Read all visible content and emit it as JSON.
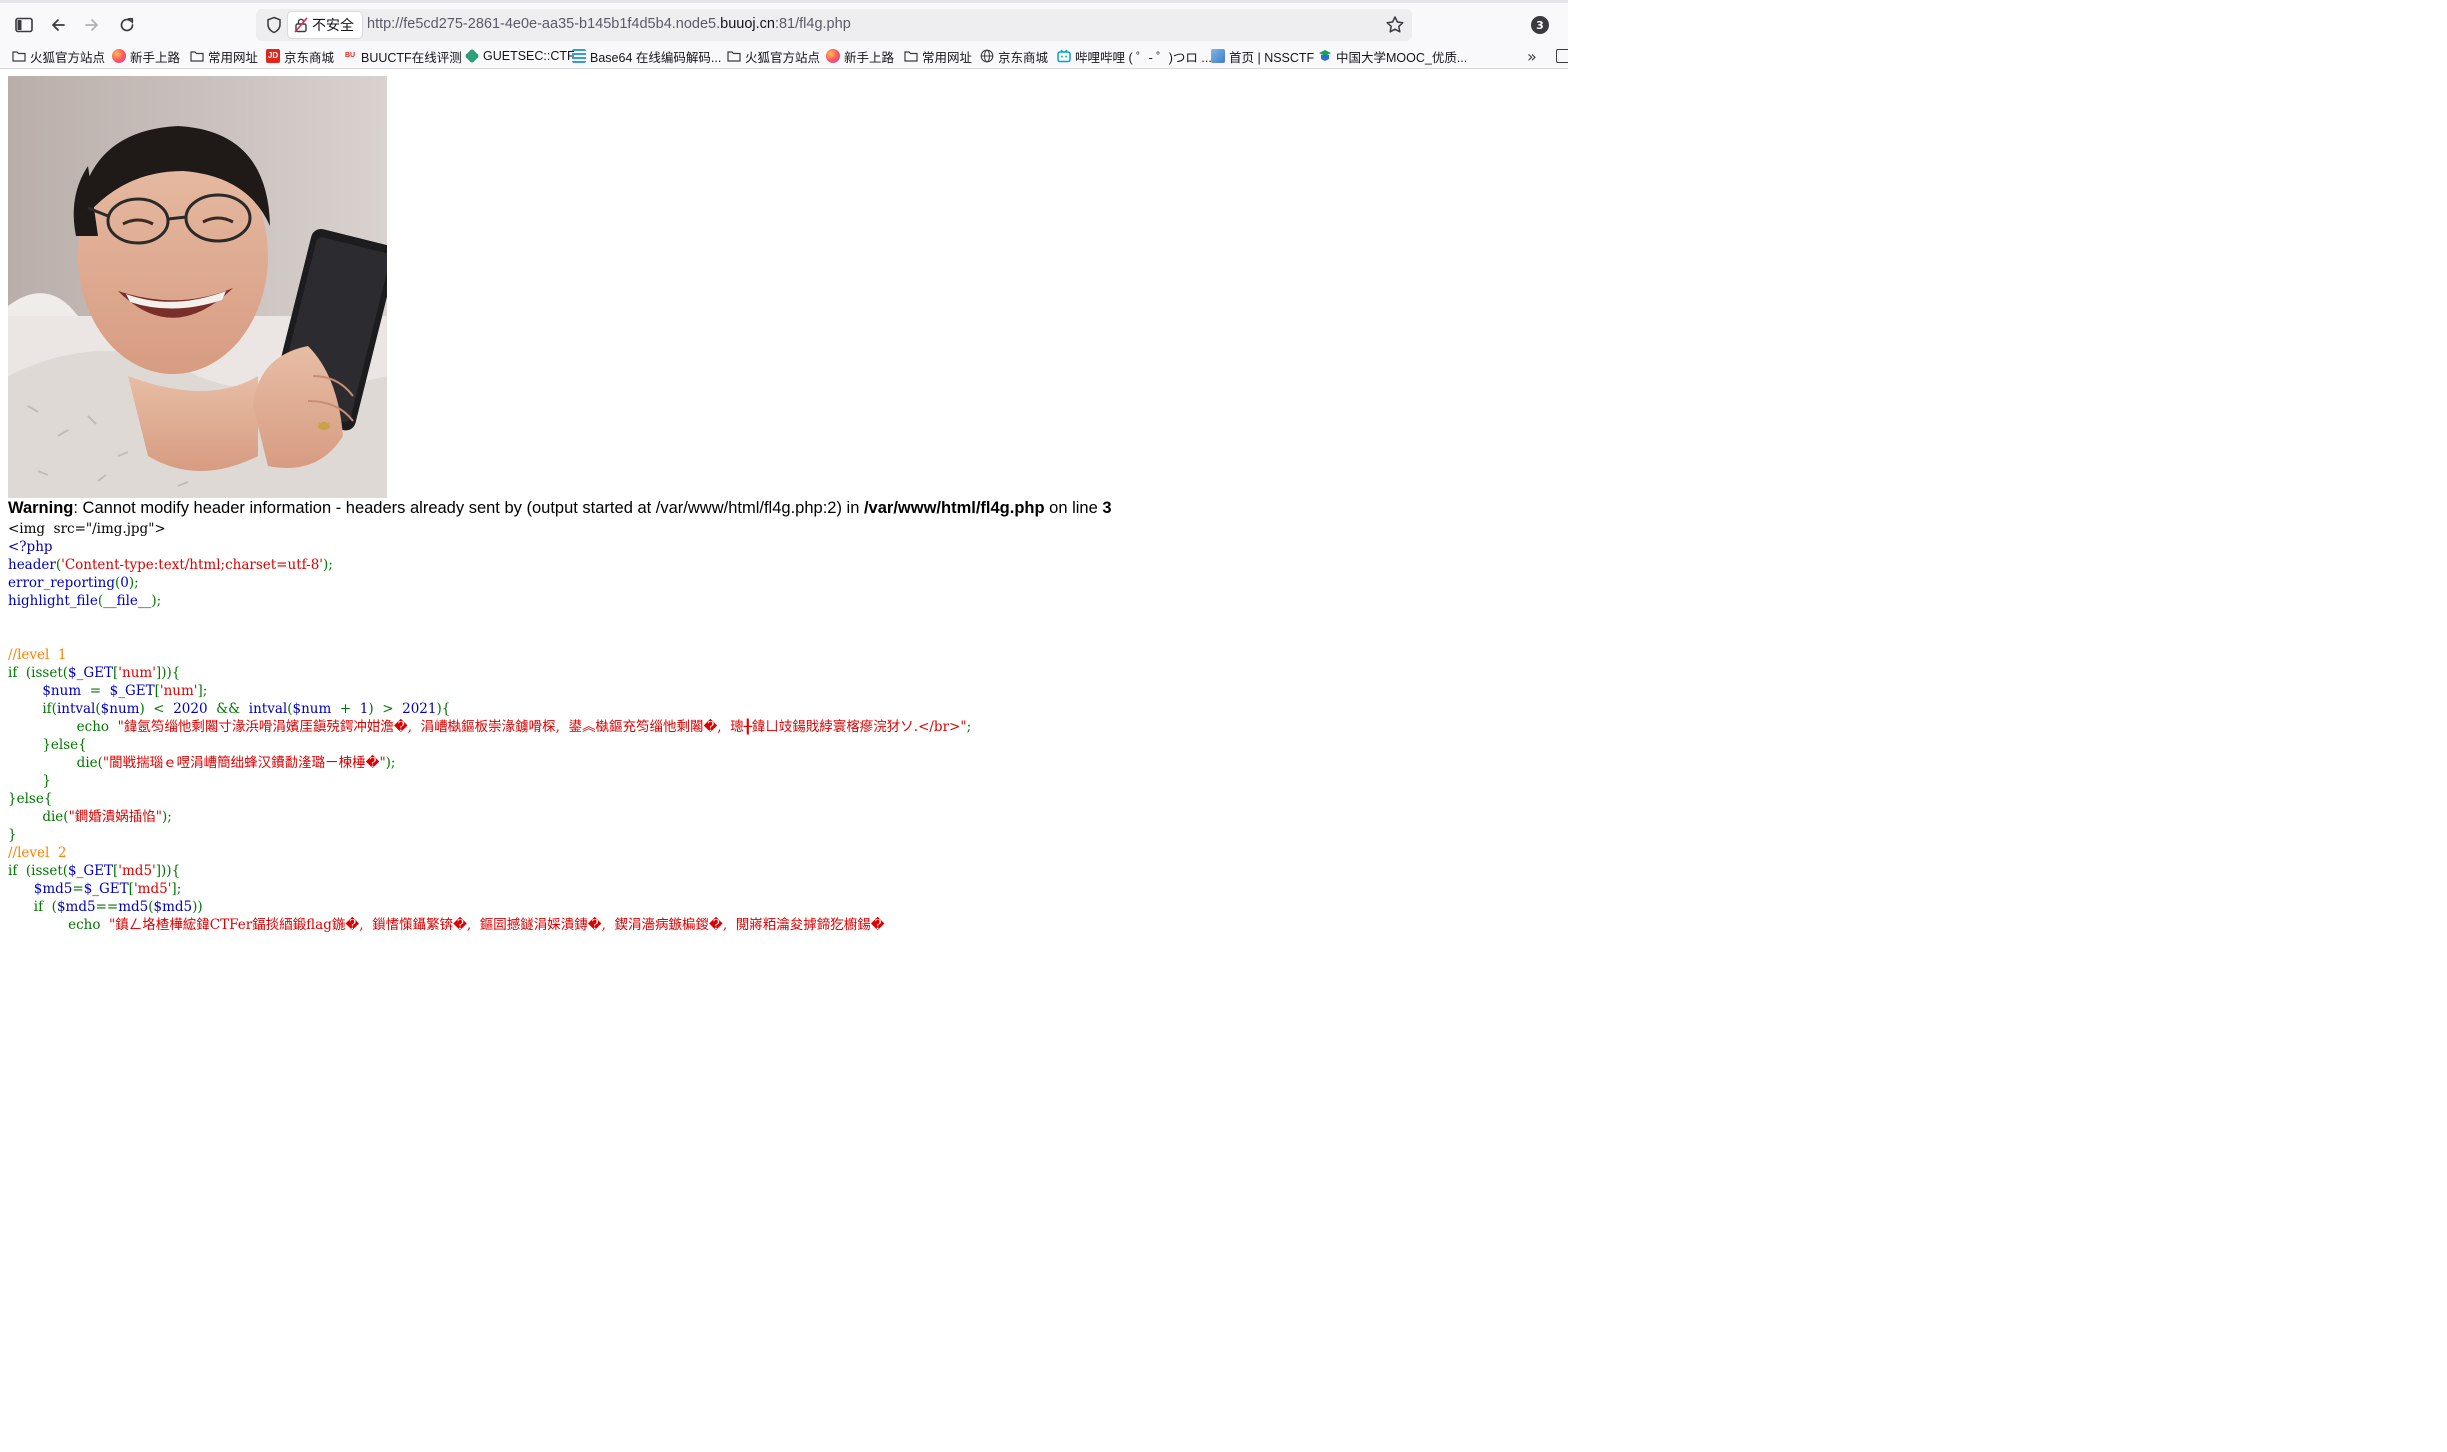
{
  "browser": {
    "address": {
      "security_label": "不安全",
      "url_prefix": "http://fe5cd275-2861-4e0e-aa35-b145b1f4d5b4.node5.",
      "url_domain": "buuoj.cn",
      "url_suffix": ":81/fl4g.php"
    },
    "extension_badge": "3",
    "bookmarks": [
      {
        "label": "火狐官方站点",
        "icon": "folder-icon"
      },
      {
        "label": "新手上路",
        "icon": "firefox-icon"
      },
      {
        "label": "常用网址",
        "icon": "folder-icon"
      },
      {
        "label": "京东商城",
        "icon": "jd-icon"
      },
      {
        "label": "BUUCTF在线评测",
        "icon": "buuctf-icon"
      },
      {
        "label": "GUETSEC::CTF",
        "icon": "guetsec-icon"
      },
      {
        "label": "Base64 在线编码解码...",
        "icon": "base64-icon"
      },
      {
        "label": "火狐官方站点",
        "icon": "folder-icon"
      },
      {
        "label": "新手上路",
        "icon": "firefox-icon"
      },
      {
        "label": "常用网址",
        "icon": "folder-icon"
      },
      {
        "label": "京东商城",
        "icon": "globe-icon"
      },
      {
        "label": "哔哩哔哩 ( ゜- ゜)つロ ...",
        "icon": "bilibili-icon"
      },
      {
        "label": "首页 | NSSCTF",
        "icon": "nssctf-icon"
      },
      {
        "label": "中国大学MOOC_优质...",
        "icon": "mooc-icon"
      }
    ]
  },
  "page": {
    "warning": {
      "label": "Warning",
      "message": ": Cannot modify header information - headers already sent by (output started at /var/www/html/fl4g.php:2) in ",
      "file": "/var/www/html/fl4g.php",
      "on_line": " on line ",
      "line": "3"
    },
    "code_lines": [
      [
        {
          "t": "<img  src=\"/img.jpg\">",
          "c": ""
        }
      ],
      [
        {
          "t": "<?php",
          "c": "k"
        }
      ],
      [
        {
          "t": "header",
          "c": "k"
        },
        {
          "t": "(",
          "c": "g"
        },
        {
          "t": "'Content-type:text/html;charset=utf-8'",
          "c": "s"
        },
        {
          "t": ");",
          "c": "g"
        }
      ],
      [
        {
          "t": "error_reporting",
          "c": "k"
        },
        {
          "t": "(",
          "c": "g"
        },
        {
          "t": "0",
          "c": "k"
        },
        {
          "t": ");",
          "c": "g"
        }
      ],
      [
        {
          "t": "highlight_file",
          "c": "k"
        },
        {
          "t": "(",
          "c": "g"
        },
        {
          "t": "__file__",
          "c": "k"
        },
        {
          "t": ");",
          "c": "g"
        }
      ],
      [
        {
          "t": "",
          "c": ""
        }
      ],
      [
        {
          "t": "",
          "c": ""
        }
      ],
      [
        {
          "t": "//level  1",
          "c": "c"
        }
      ],
      [
        {
          "t": "if  ",
          "c": "g"
        },
        {
          "t": "(isset(",
          "c": "g"
        },
        {
          "t": "$_GET",
          "c": "k"
        },
        {
          "t": "[",
          "c": "g"
        },
        {
          "t": "'num'",
          "c": "s"
        },
        {
          "t": "])){",
          "c": "g"
        }
      ],
      [
        {
          "t": "        ",
          "c": ""
        },
        {
          "t": "$num  ",
          "c": "k"
        },
        {
          "t": "=  ",
          "c": "g"
        },
        {
          "t": "$_GET",
          "c": "k"
        },
        {
          "t": "[",
          "c": "g"
        },
        {
          "t": "'num'",
          "c": "s"
        },
        {
          "t": "];",
          "c": "g"
        }
      ],
      [
        {
          "t": "        ",
          "c": ""
        },
        {
          "t": "if(",
          "c": "g"
        },
        {
          "t": "intval",
          "c": "k"
        },
        {
          "t": "(",
          "c": "g"
        },
        {
          "t": "$num",
          "c": "k"
        },
        {
          "t": ")  <  ",
          "c": "g"
        },
        {
          "t": "2020  ",
          "c": "k"
        },
        {
          "t": "&&  ",
          "c": "g"
        },
        {
          "t": "intval",
          "c": "k"
        },
        {
          "t": "(",
          "c": "g"
        },
        {
          "t": "$num  ",
          "c": "k"
        },
        {
          "t": "+  ",
          "c": "g"
        },
        {
          "t": "1",
          "c": "k"
        },
        {
          "t": ")  >  ",
          "c": "g"
        },
        {
          "t": "2021",
          "c": "k"
        },
        {
          "t": "){",
          "c": "g"
        }
      ],
      [
        {
          "t": "                ",
          "c": ""
        },
        {
          "t": "echo  ",
          "c": "g"
        },
        {
          "t": "\"鍏氬笉缁忚剩闂寸湪浜嗗涓嬪厓鎭殑鍔冲姏澹�,  涓嶆槸鏂板崇湪鐪嗗棎,  鍙︽槸鏂充笉缁忚剩闂�,  璁╂鍏ㄩ攱鍚戝綍寰楁瘮浣犲ソ.</br>\"",
          "c": "s"
        },
        {
          "t": ";",
          "c": "g"
        }
      ],
      [
        {
          "t": "        ",
          "c": ""
        },
        {
          "t": "}else{",
          "c": "g"
        }
      ],
      [
        {
          "t": "                ",
          "c": ""
        },
        {
          "t": "die(",
          "c": "g"
        },
        {
          "t": "\"閬戦揣瑙ｅ喅涓嶆簡绌蜂汉鐨勫湰璐ㄧ楝棰�\"",
          "c": "s"
        },
        {
          "t": ");",
          "c": "g"
        }
      ],
      [
        {
          "t": "        ",
          "c": ""
        },
        {
          "t": "}",
          "c": "g"
        }
      ],
      [
        {
          "t": "}else{",
          "c": "g"
        }
      ],
      [
        {
          "t": "        ",
          "c": ""
        },
        {
          "t": "die(",
          "c": "g"
        },
        {
          "t": "\"鐧婚潰娲插惂\"",
          "c": "s"
        },
        {
          "t": ");",
          "c": "g"
        }
      ],
      [
        {
          "t": "}",
          "c": "g"
        }
      ],
      [
        {
          "t": "//level  2",
          "c": "c"
        }
      ],
      [
        {
          "t": "if  ",
          "c": "g"
        },
        {
          "t": "(isset(",
          "c": "g"
        },
        {
          "t": "$_GET",
          "c": "k"
        },
        {
          "t": "[",
          "c": "g"
        },
        {
          "t": "'md5'",
          "c": "s"
        },
        {
          "t": "])){",
          "c": "g"
        }
      ],
      [
        {
          "t": "      ",
          "c": ""
        },
        {
          "t": "$md5",
          "c": "k"
        },
        {
          "t": "=",
          "c": "g"
        },
        {
          "t": "$_GET",
          "c": "k"
        },
        {
          "t": "[",
          "c": "g"
        },
        {
          "t": "'md5'",
          "c": "s"
        },
        {
          "t": "];",
          "c": "g"
        }
      ],
      [
        {
          "t": "      ",
          "c": ""
        },
        {
          "t": "if  ",
          "c": "g"
        },
        {
          "t": "(",
          "c": "g"
        },
        {
          "t": "$md5",
          "c": "k"
        },
        {
          "t": "==",
          "c": "g"
        },
        {
          "t": "md5",
          "c": "k"
        },
        {
          "t": "(",
          "c": "g"
        },
        {
          "t": "$md5",
          "c": "k"
        },
        {
          "t": "))",
          "c": "g"
        }
      ],
      [
        {
          "t": "              ",
          "c": ""
        },
        {
          "t": "echo  ",
          "c": "g"
        },
        {
          "t": "\"鎮ㄥ垎楂樺綋鍏CTFer鍢掞綇鍛flag鍦�,  鎻愭憡鑷繁锛�,  鏂囩撼鐩涓婇潰鏄�,  鍥涓濇病鏃楄鍐�,  閲嶈粨瀹夋摢鍗犵櫥鍚�",
          "c": "s"
        }
      ]
    ]
  }
}
